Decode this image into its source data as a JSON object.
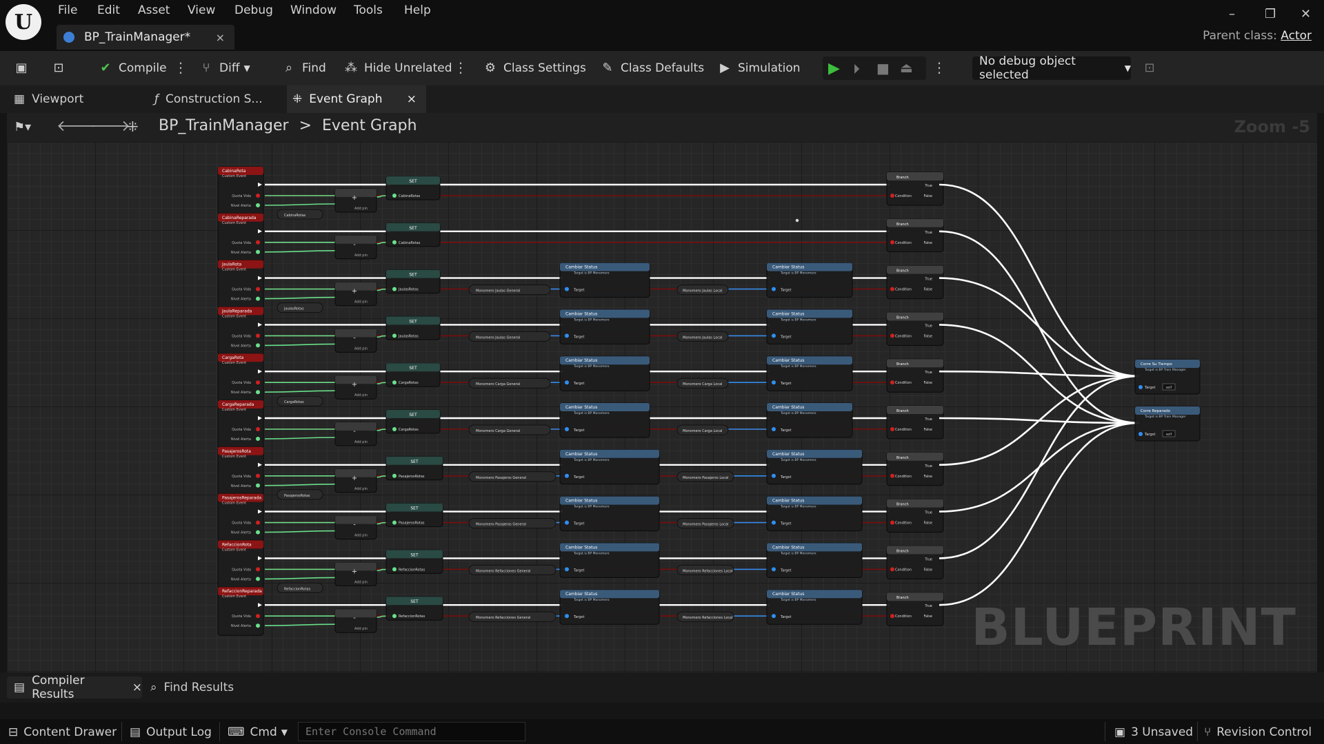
{
  "app": {
    "logo_text": "U",
    "tab_title": "BP_TrainManager*",
    "tab_close": "×",
    "parent_class_label": "Parent class:",
    "parent_class_value": "Actor"
  },
  "menu": [
    "File",
    "Edit",
    "Asset",
    "View",
    "Debug",
    "Window",
    "Tools",
    "Help"
  ],
  "window_controls": {
    "minimize": "–",
    "restore": "❐",
    "close": "✕"
  },
  "toolbar": {
    "compile": "Compile",
    "diff": "Diff",
    "find": "Find",
    "hide_unrelated": "Hide Unrelated",
    "class_settings": "Class Settings",
    "class_defaults": "Class Defaults",
    "simulation": "Simulation",
    "debug_select": "No debug object selected"
  },
  "editor_tabs": {
    "viewport": "Viewport",
    "construction": "Construction S...",
    "event_graph": "Event Graph",
    "close": "×"
  },
  "breadcrumb": {
    "root": "BP_TrainManager",
    "sep": ">",
    "current": "Event Graph",
    "zoom": "Zoom -5"
  },
  "graph": {
    "watermark": "BLUEPRINT",
    "event_subtitle": "Custom Event",
    "pin_labels": {
      "quota": "Quota Vida",
      "level": "Nivel Alerta",
      "target": "Target",
      "condition": "Condition",
      "true": "True",
      "false": "False",
      "self": "self"
    },
    "set_label": "SET",
    "branch_label": "Branch",
    "addsub_label": "Add pin",
    "change_status": "Cambiar Status",
    "change_status_sub": "Target is BP Monomero",
    "rows": [
      {
        "event": "CabinaRota",
        "var": "CabinaRotas",
        "gen": "",
        "loc": "",
        "op": "+"
      },
      {
        "event": "CabinaReparada",
        "var": "CabinaRotas",
        "gen": "",
        "loc": "",
        "op": "-"
      },
      {
        "event": "JaulaRota",
        "var": "JaulasRotas",
        "gen": "Monomero Jaulas General",
        "loc": "Monomero Jaulas Local",
        "op": "+"
      },
      {
        "event": "JaulaReparada",
        "var": "JaulasRotas",
        "gen": "Monomero Jaulas General",
        "loc": "Monomero Jaulas Local",
        "op": "-"
      },
      {
        "event": "CargaRota",
        "var": "CargaRotas",
        "gen": "Monomero Carga General",
        "loc": "Monomero Carga Local",
        "op": "+"
      },
      {
        "event": "CargaReparada",
        "var": "CargaRotas",
        "gen": "Monomero Carga General",
        "loc": "Monomero Carga Local",
        "op": "-"
      },
      {
        "event": "PasajerosRota",
        "var": "PasajerosRotas",
        "gen": "Monomero Pasajeros General",
        "loc": "Monomero Pasajeros Local",
        "op": "+"
      },
      {
        "event": "PasajerosReparada",
        "var": "PasajerosRotas",
        "gen": "Monomero Pasajeros General",
        "loc": "Monomero Pasajeros Local",
        "op": "-"
      },
      {
        "event": "RefaccionRota",
        "var": "RefaccionRotas",
        "gen": "Monomero Refacciones General",
        "loc": "Monomero Refacciones Local",
        "op": "+"
      },
      {
        "event": "RefaccionReparada",
        "var": "RefaccionRotas",
        "gen": "Monomero Refacciones General",
        "loc": "Monomero Refacciones Local",
        "op": "-"
      }
    ],
    "collapsed_vars": [
      "CabinaRotas",
      "JaulasRotas",
      "CargaRotas",
      "PasajerosRotas",
      "RefaccionRotas"
    ],
    "funcs": [
      {
        "title": "Corre Su Tiempo",
        "sub": "Target is BP Train Manager"
      },
      {
        "title": "Corre Reparado",
        "sub": "Target is BP Train Manager"
      }
    ]
  },
  "bottom_tabs": {
    "compiler_results": "Compiler Results",
    "close": "×",
    "find_results": "Find Results"
  },
  "statusbar": {
    "content_drawer": "Content Drawer",
    "output_log": "Output Log",
    "cmd": "Cmd",
    "console_placeholder": "Enter Console Command",
    "unsaved": "3 Unsaved",
    "revision_control": "Revision Control"
  },
  "colors": {
    "event_red": "#8c1414",
    "exec_white": "#ffffff",
    "float_green": "#6ae08c",
    "obj_blue": "#2f8ff0",
    "bool_red": "#a01010",
    "accent_play": "#3cbf3c"
  }
}
